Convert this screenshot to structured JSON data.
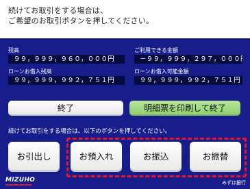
{
  "header": {
    "line1": "続けてお取引をする場合は、",
    "line2": "ご希望のお取引ボタンを押してください。"
  },
  "accounts": {
    "balance": {
      "label": "残高",
      "value": "９９，９９９，９６０，０００円"
    },
    "available": {
      "label": "ご利用できる金額",
      "value": "－９９，９９９，２９７，０００円"
    },
    "loan_balance": {
      "label": "ローンお借入残高",
      "value": "９９，９９９，９９２，７５１円"
    },
    "loan_available": {
      "label": "ローンお借入可能金額",
      "value": "９９，９９９，９９２，７５１円"
    }
  },
  "buttons": {
    "end": "終了",
    "print_end": "明細票を印刷して終了"
  },
  "continue_text": "続けてお取引をする場合は、以下のボタンを押してください。",
  "transactions": [
    {
      "label": "お引出し"
    },
    {
      "label": "お預入れ"
    },
    {
      "label": "お振込"
    },
    {
      "label": "お振替"
    }
  ],
  "brand": {
    "logo": "MIZUHO",
    "bank_name": "みずほ銀行",
    "accent_color": "#e5162a",
    "screen_color": "#171e8c"
  }
}
